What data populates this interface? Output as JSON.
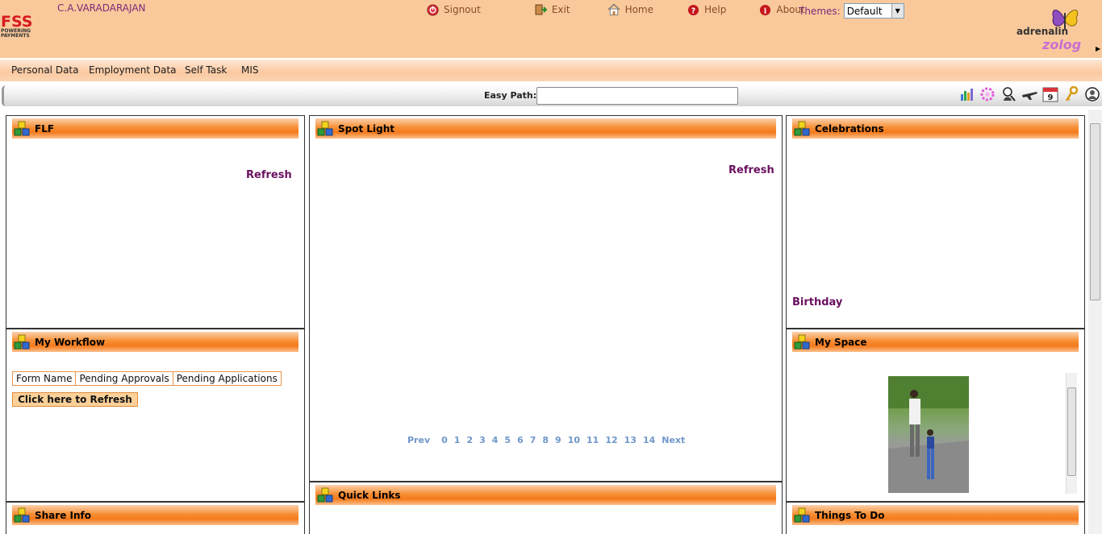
{
  "header": {
    "logo_text": "FSS",
    "logo_tagline_1": "POWERING",
    "logo_tagline_2": "PAYMENTS",
    "username": "C.A.VARADARAJAN",
    "nav": [
      {
        "label": "Signout",
        "icon": "signout-icon"
      },
      {
        "label": "Exit",
        "icon": "exit-icon"
      },
      {
        "label": "Home",
        "icon": "home-icon"
      },
      {
        "label": "Help",
        "icon": "help-icon"
      },
      {
        "label": "About",
        "icon": "about-icon"
      }
    ],
    "themes_label": "Themes:",
    "themes_value": "Default",
    "brand_1": "adrenalin",
    "brand_2": "zolog"
  },
  "menu": [
    "Personal Data",
    "Employment Data",
    "Self Task",
    "MIS"
  ],
  "easypath": {
    "label": "Easy Path:",
    "value": ""
  },
  "toolbar_icons": [
    "chart-icon",
    "gear-flower-icon",
    "person-search-icon",
    "plane-icon",
    "calendar-icon",
    "key-icon",
    "user-help-icon"
  ],
  "calendar_day": "9",
  "panels": {
    "flf": {
      "title": "FLF",
      "refresh": "Refresh"
    },
    "spotlight": {
      "title": "Spot Light",
      "refresh": "Refresh",
      "pager": [
        "Prev",
        "0",
        "1",
        "2",
        "3",
        "4",
        "5",
        "6",
        "7",
        "8",
        "9",
        "10",
        "11",
        "12",
        "13",
        "14",
        "Next"
      ]
    },
    "celebrations": {
      "title": "Celebrations",
      "birthday": "Birthday"
    },
    "workflow": {
      "title": "My Workflow",
      "columns": [
        "Form Name",
        "Pending Approvals",
        "Pending Applications"
      ],
      "button": "Click here to Refresh"
    },
    "myspace": {
      "title": "My Space"
    },
    "quicklinks": {
      "title": "Quick Links"
    },
    "shareinfo": {
      "title": "Share Info"
    },
    "thingstodo": {
      "title": "Things To Do"
    }
  },
  "colors": {
    "header_bg": "#f9c99b",
    "accent_orange": "#f47a1c",
    "link_purple": "#6a1060",
    "pager_blue": "#6f97c9"
  }
}
